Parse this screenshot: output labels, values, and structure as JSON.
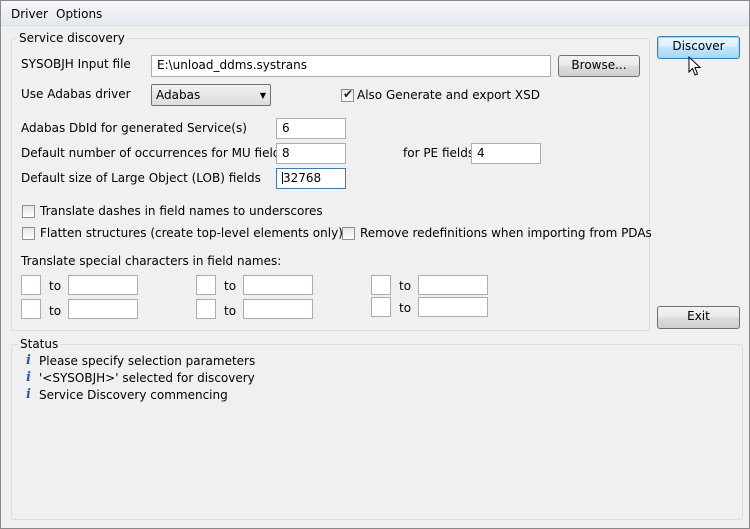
{
  "menu": {
    "items": [
      "Driver",
      "Options"
    ]
  },
  "discovery": {
    "legend": "Service discovery",
    "input_file_label": "SYSOBJH Input file",
    "input_file_value": "E:\\unload_ddms.systrans",
    "browse_label": "Browse...",
    "driver_label": "Use Adabas driver",
    "driver_value": "Adabas",
    "xsd_label": "Also Generate and export XSD",
    "xsd_checked": true,
    "dbid_label": "Adabas DbId for generated Service(s)",
    "dbid_value": "6",
    "occ_label": "Default number of occurrences  for MU fields",
    "occ_value": "8",
    "pe_label": "for PE fields",
    "pe_value": "4",
    "lob_label": "Default size of Large Object (LOB) fields",
    "lob_value": "32768",
    "dashes_label": "Translate dashes in field names to underscores",
    "flatten_label": "Flatten structures (create top-level elements only)",
    "redefs_label": "Remove redefinitions when importing from PDAs",
    "special_label": "Translate special characters in field names:",
    "to_label": "to"
  },
  "buttons": {
    "discover": "Discover",
    "exit": "Exit"
  },
  "status": {
    "legend": "Status",
    "messages": [
      "Please specify selection parameters",
      "'<SYSOBJH>' selected for discovery",
      "Service Discovery commencing"
    ]
  },
  "icons": {
    "info": "i"
  }
}
